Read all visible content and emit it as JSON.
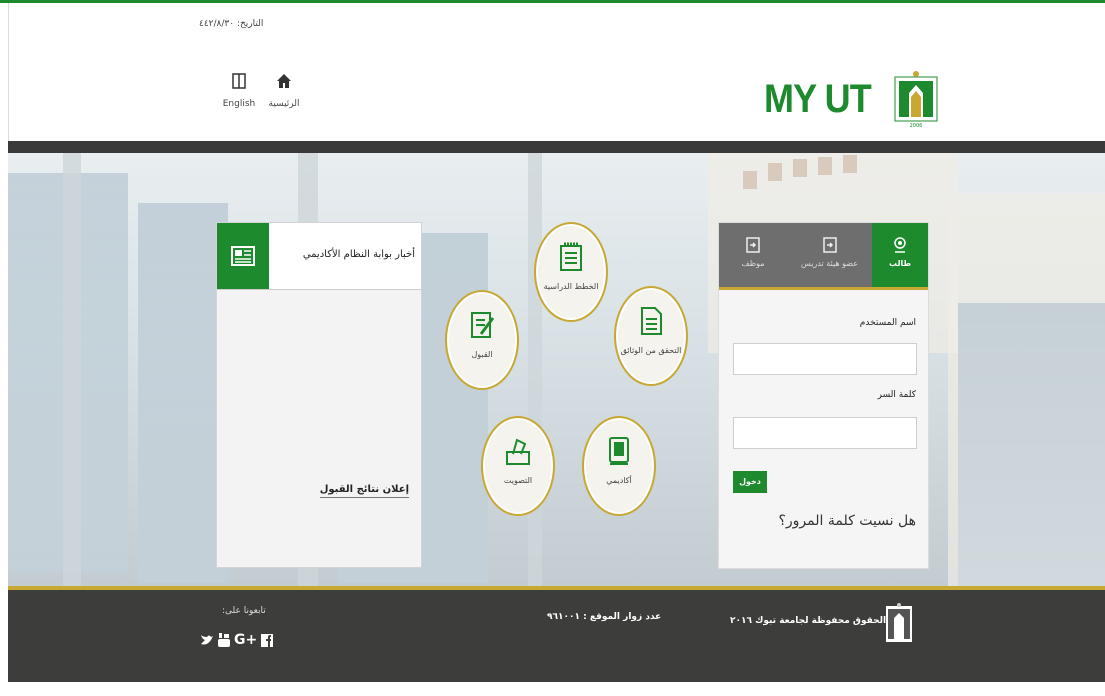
{
  "header": {
    "date_label": "التاريخ: ٤٤٢/٨/٣٠",
    "nav": [
      {
        "label": "English",
        "icon": "book-icon"
      },
      {
        "label": "الرئيسية",
        "icon": "home-icon"
      }
    ],
    "logo_text": "MY UT",
    "logo_year": "2006"
  },
  "news": {
    "title": "أخبار بوابة النظام الأكاديمي",
    "item": "إعلان نتائج القبول"
  },
  "services": [
    {
      "label": "الخطط الدراسية",
      "icon": "study-plan-icon"
    },
    {
      "label": "القبول",
      "icon": "admission-icon"
    },
    {
      "label": "التحقق من الوثائق",
      "icon": "document-verify-icon"
    },
    {
      "label": "التصويت",
      "icon": "vote-icon"
    },
    {
      "label": "أكاديمي",
      "icon": "academic-book-icon"
    }
  ],
  "login": {
    "tabs": [
      {
        "label": "طالب",
        "active": true
      },
      {
        "label": "عضو هيئة تدريس",
        "active": false
      },
      {
        "label": "موظف",
        "active": false
      }
    ],
    "username_label": "اسم المستخدم",
    "password_label": "كلمة السر",
    "submit_label": "دخول",
    "forgot_label": "هل نسيت كلمة المرور؟"
  },
  "footer": {
    "follow_label": "تابعونا على:",
    "social": [
      "twitter-icon",
      "youtube-icon",
      "google-plus-icon",
      "facebook-icon"
    ],
    "google_plus_text": "G+",
    "visits_label": "عدد زوار الموقع : ٩٦١٠٠١",
    "rights_label": "جميع الحقوق محفوظة لجامعة تبوك ٢٠١٦"
  },
  "colors": {
    "brand": "#1d8a2e",
    "gold": "#c8a732",
    "dark": "#3d3d3b"
  }
}
